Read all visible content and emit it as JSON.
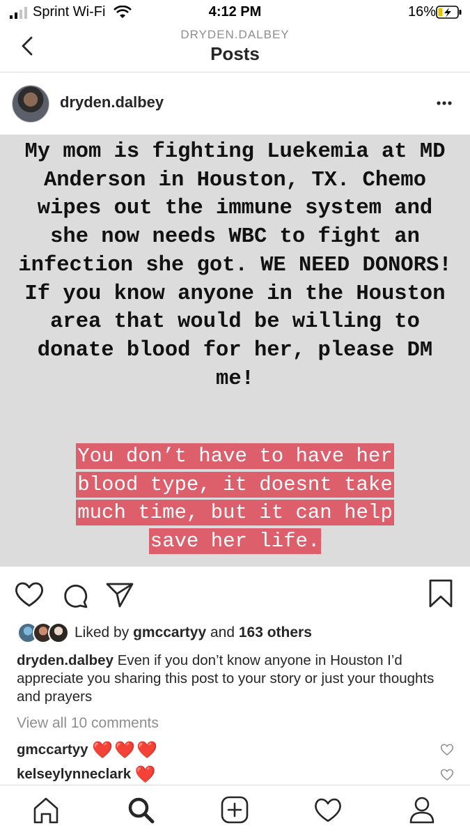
{
  "status_bar": {
    "carrier": "Sprint Wi-Fi",
    "time": "4:12 PM",
    "battery": "16%"
  },
  "header": {
    "subtitle": "DRYDEN.DALBEY",
    "title": "Posts"
  },
  "post": {
    "username": "dryden.dalbey",
    "story_text": "My mom is fighting Luekemia at MD Anderson in Houston, TX. Chemo wipes out the immune system and she now needs WBC to fight an infection she got. WE NEED DONORS! If you know anyone in the Houston area that would be willing to donate blood for her, please DM me!",
    "highlight_lines": [
      "You don’t have to have her",
      "blood type, it doesnt take",
      "much time, but it can help",
      "save her life."
    ],
    "liked_by_prefix": "Liked by",
    "liked_by_user": "gmccartyy",
    "liked_by_and": "and",
    "liked_by_others": "163 others",
    "caption_user": "dryden.dalbey",
    "caption_text": "Even if you don’t know anyone in Houston I’d appreciate you sharing this post to your story or just your thoughts and prayers",
    "view_comments": "View all 10 comments",
    "comments": [
      {
        "user": "gmccartyy",
        "text": "❤️❤️❤️"
      },
      {
        "user": "kelseylynneclark",
        "text": "❤️"
      }
    ]
  },
  "colors": {
    "highlight_bg": "#dd5f6c",
    "image_bg": "#dcdcdc",
    "heart_red": "#e8222d",
    "muted": "#8e8e8e"
  },
  "icons": {
    "back": "chevron-left-icon",
    "more": "ellipsis-icon",
    "like": "heart-icon",
    "comment": "comment-bubble-icon",
    "share": "send-icon",
    "save": "bookmark-icon",
    "home": "home-icon",
    "search": "search-icon",
    "new_post": "plus-square-icon",
    "activity": "heart-icon",
    "profile": "person-icon"
  }
}
